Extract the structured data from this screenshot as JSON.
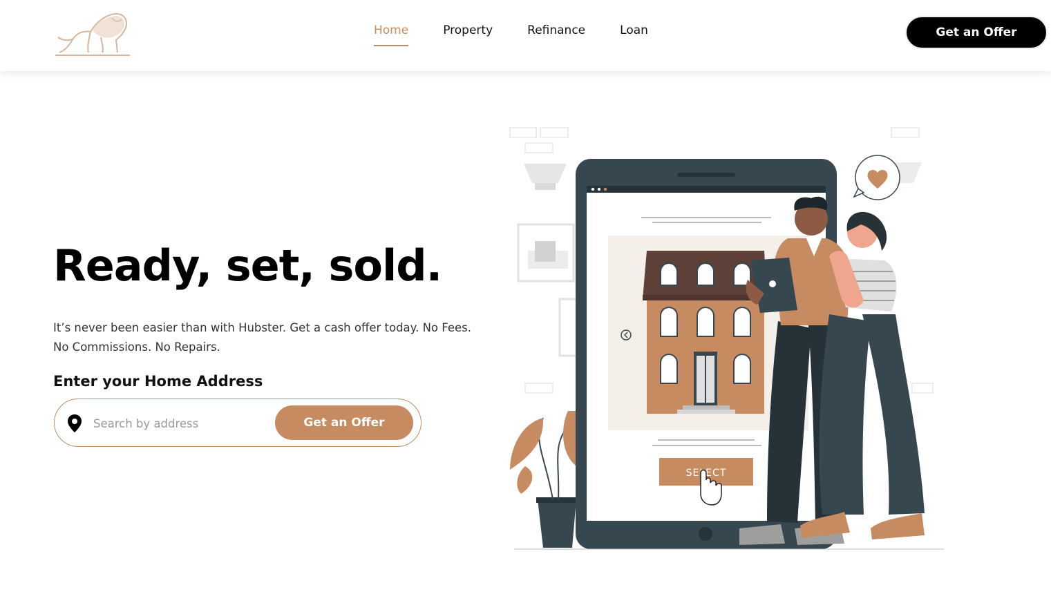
{
  "header": {
    "nav": [
      {
        "label": "Home",
        "active": true
      },
      {
        "label": "Property",
        "active": false
      },
      {
        "label": "Refinance",
        "active": false
      },
      {
        "label": "Loan",
        "active": false
      }
    ],
    "cta_label": "Get an Offer"
  },
  "hero": {
    "title": "Ready, set, sold.",
    "subtitle": "It’s never been easier than with Hubster. Get a cash offer today. No Fees. No Commissions. No Repairs.",
    "address_label": "Enter your Home Address",
    "search": {
      "placeholder": "Search by address",
      "value": "",
      "button_label": "Get an Offer"
    }
  },
  "illustration": {
    "select_label": "SELECT"
  },
  "colors": {
    "accent": "#c78b61",
    "dark": "#37474f",
    "black": "#000000"
  },
  "icons": {
    "logo": "lion-logo",
    "search_pin": "location-pin-icon",
    "heart": "heart-icon",
    "cursor": "pointer-hand-icon"
  }
}
